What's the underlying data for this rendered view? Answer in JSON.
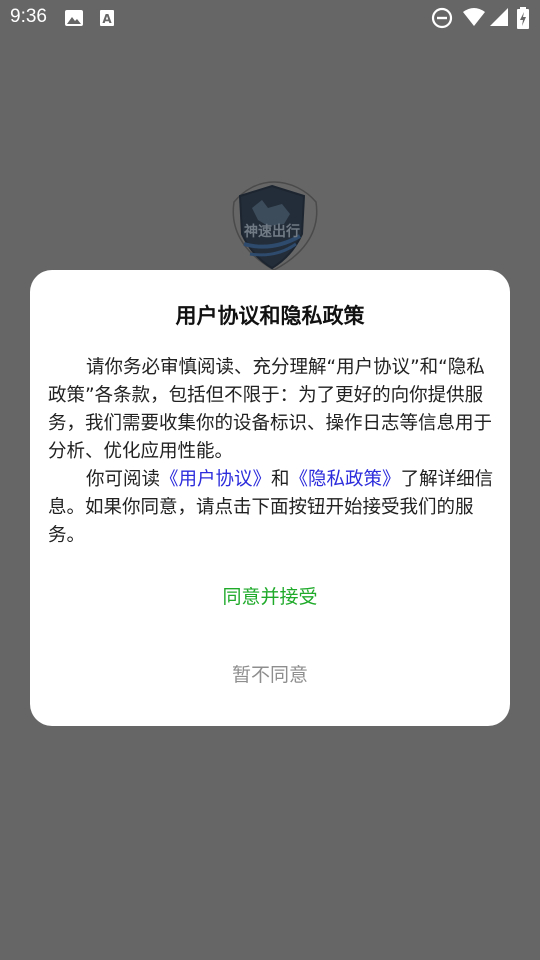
{
  "status_bar": {
    "time": "9:36",
    "left_icons": [
      "image-icon",
      "text-a-icon"
    ],
    "right_icons": [
      "do-not-disturb-icon",
      "wifi-icon",
      "signal-icon",
      "battery-charging-icon"
    ]
  },
  "background": {
    "logo_text": "神速出行"
  },
  "dialog": {
    "title": "用户协议和隐私政策",
    "paragraph1": "请你务必审慎阅读、充分理解“用户协议”和“隐私政策”各条款，包括但不限于：为了更好的向你提供服务，我们需要收集你的设备标识、操作日志等信息用于分析、优化应用性能。",
    "paragraph2_prefix": "你可阅读",
    "user_agreement_link": "《用户协议》",
    "paragraph2_and": "和",
    "privacy_policy_link": "《隐私政策》",
    "paragraph2_suffix": "了解详细信息。如果你同意，请点击下面按钮开始接受我们的服务。",
    "agree_label": "同意并接受",
    "decline_label": "暂不同意"
  },
  "colors": {
    "overlay": "#666666",
    "dialog_bg": "#ffffff",
    "link": "#2c2cdc",
    "agree": "#1faa2a",
    "decline": "#8e8e8e"
  }
}
